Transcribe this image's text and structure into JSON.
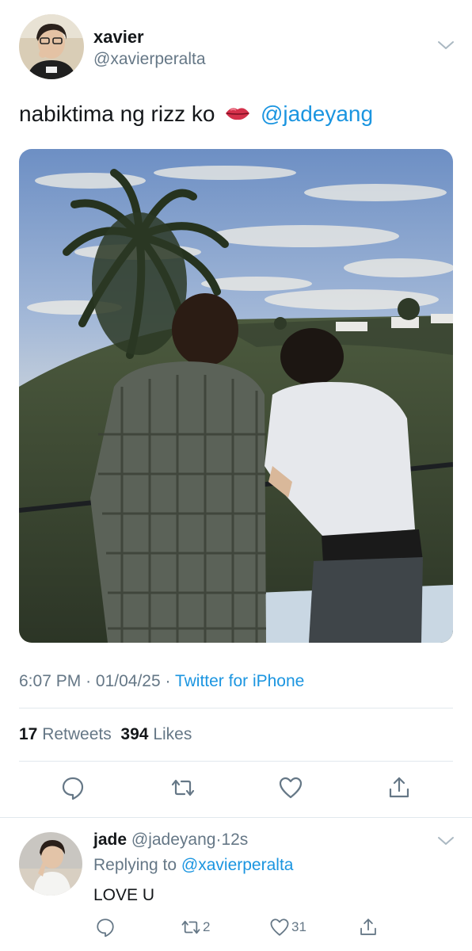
{
  "tweet": {
    "display_name": "xavier",
    "handle": "@xavierperalta",
    "text": "nabiktima ng rizz ko",
    "emoji": "lips",
    "mention": "@jadeyang",
    "time": "6:07 PM",
    "date": "01/04/25",
    "source": "Twitter for iPhone",
    "retweets_count": "17",
    "retweets_label": "Retweets",
    "likes_count": "394",
    "likes_label": "Likes"
  },
  "actions": [
    {
      "icon": "reply-icon"
    },
    {
      "icon": "retweet-icon"
    },
    {
      "icon": "like-icon"
    },
    {
      "icon": "share-icon"
    }
  ],
  "reply": {
    "display_name": "jade",
    "handle": "@jadeyang",
    "time": "12s",
    "replying_label": "Replying to",
    "replying_to": "@xavierperalta",
    "text": "LOVE U",
    "retweet_count": "2",
    "like_count": "31"
  },
  "colors": {
    "link": "#1b95e0",
    "secondary_text": "#657786",
    "primary_text": "#14171a",
    "divider": "#e1e8ed"
  }
}
